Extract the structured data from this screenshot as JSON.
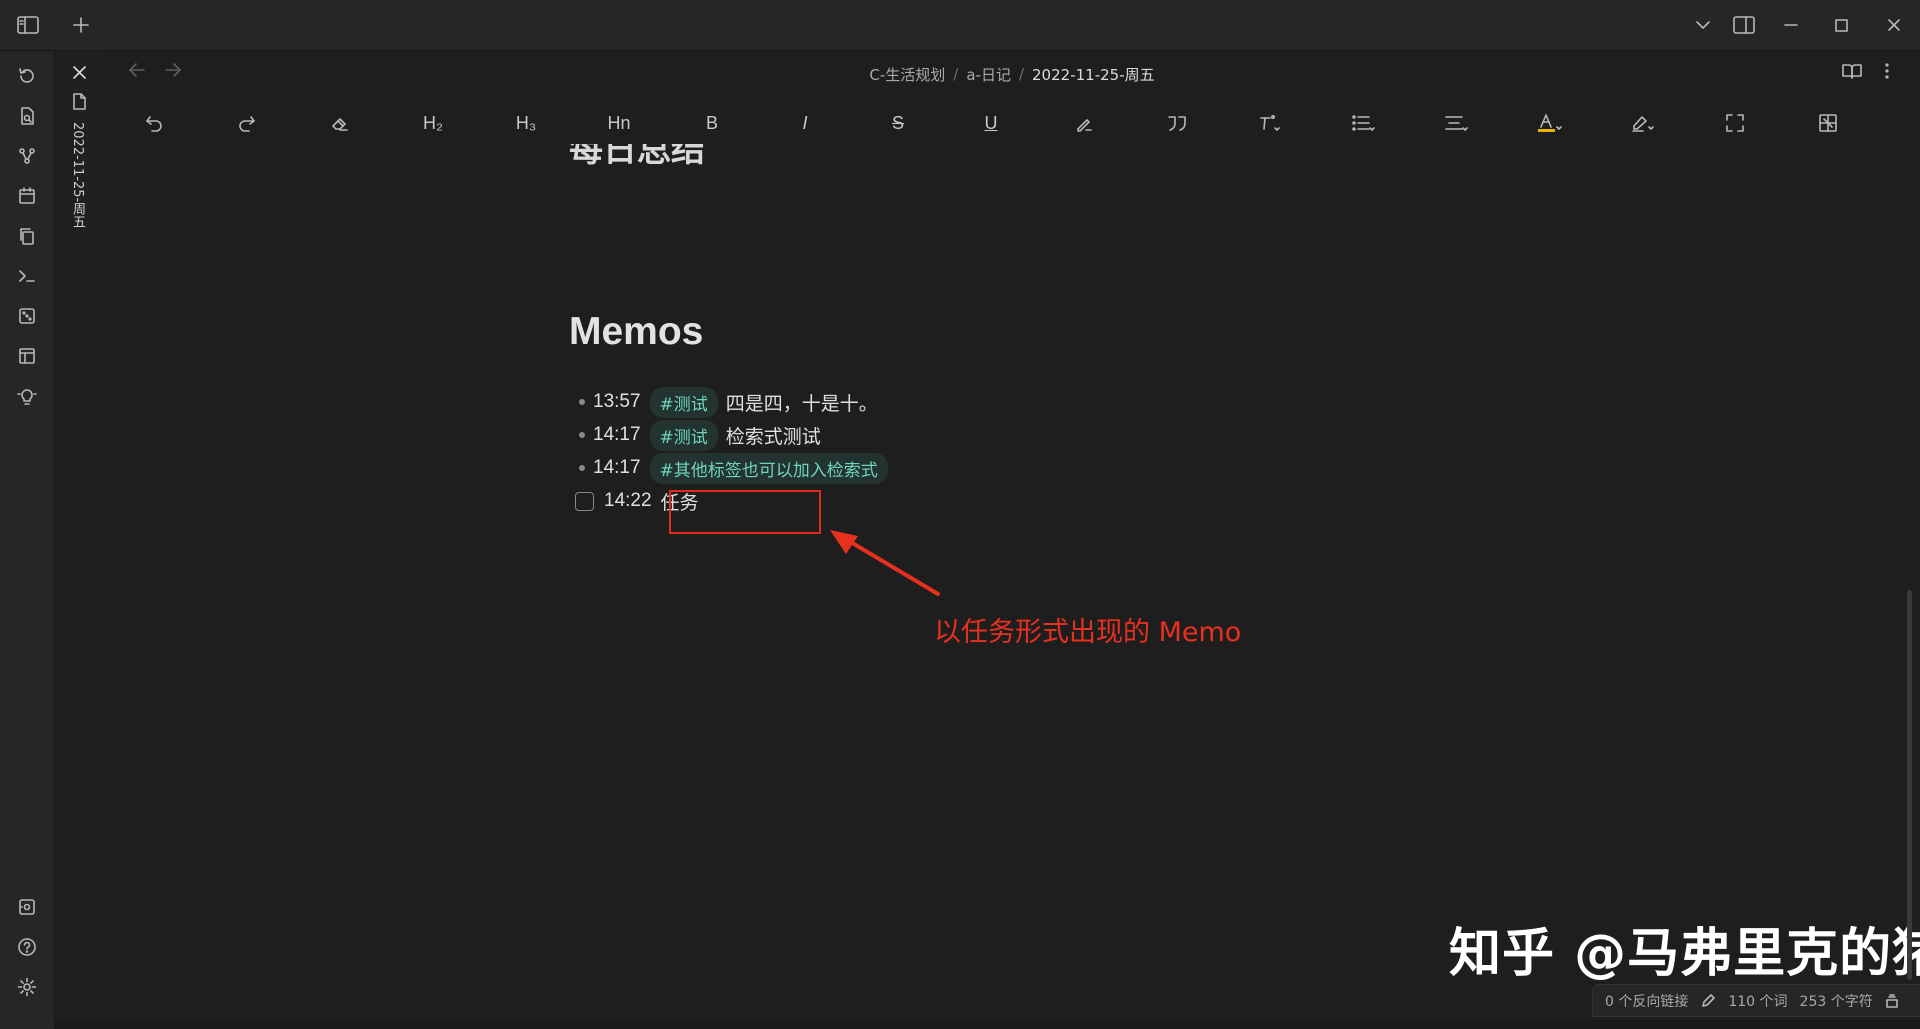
{
  "titlebar": {
    "icons": [
      "sidebar-toggle-icon",
      "new-tab-icon",
      "chevron-down-icon",
      "right-sidebar-icon",
      "minimize-icon",
      "maximize-icon",
      "close-icon"
    ]
  },
  "ribbon": {
    "icons": [
      "history-icon",
      "file-search-icon",
      "graph-icon",
      "calendar-icon",
      "copy-icon",
      "terminal-icon",
      "dice-icon",
      "template-icon",
      "lightbulb-icon",
      "vault-icon",
      "help-icon",
      "settings-icon"
    ]
  },
  "tab": {
    "title": "2022-11-25-周五"
  },
  "breadcrumb": {
    "part1": "C-生活规划",
    "part2": "a-日记",
    "current": "2022-11-25-周五",
    "separator": "/"
  },
  "toolbar": {
    "h2": "H₂",
    "h3": "H₃",
    "hn": "Hn",
    "bold": "B",
    "italic": "I",
    "strike": "S",
    "underline": "U"
  },
  "doc": {
    "cut_heading": "每日总结",
    "memos_heading": "Memos",
    "memos": [
      {
        "time": "13:57",
        "tag": "#测试",
        "text": "四是四，十是十。"
      },
      {
        "time": "14:17",
        "tag": "#测试",
        "text": "检索式测试"
      },
      {
        "time": "14:17",
        "tag": "#其他标签也可以加入检索式",
        "text": ""
      }
    ],
    "task": {
      "time": "14:22",
      "text": "任务"
    },
    "annotation": "以任务形式出现的 Memo"
  },
  "watermark": "知乎 @马弗里克的猪",
  "status": {
    "backlinks": "0 个反向链接",
    "words": "110 个词",
    "chars": "253 个字符"
  },
  "colors": {
    "accent_red": "#e32b1d",
    "tag_text": "#6fd3bf",
    "tag_bg": "#23332f",
    "highlight_yellow": "#e8b400"
  }
}
